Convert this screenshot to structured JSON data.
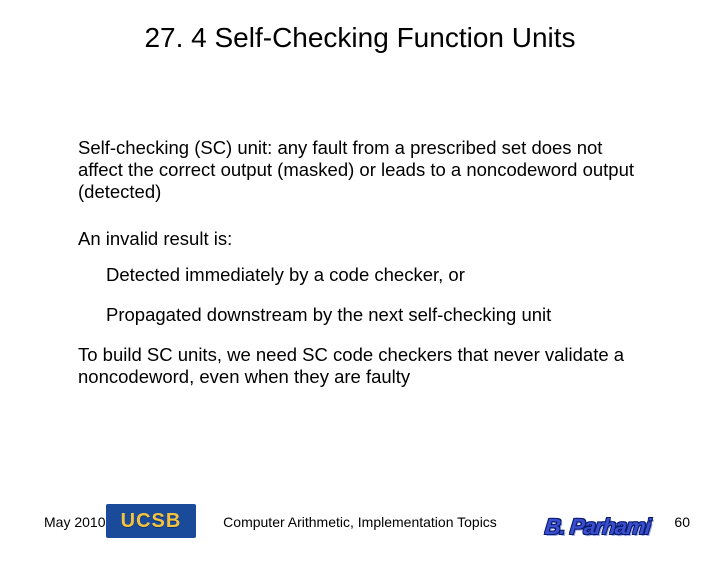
{
  "title": "27. 4  Self-Checking Function Units",
  "body": {
    "p1": "Self-checking (SC) unit: any fault from a prescribed set does not affect the correct output (masked) or leads to a noncodeword output (detected)",
    "p2": "An invalid result is:",
    "item1": "Detected immediately by a code checker, or",
    "item2": "Propagated downstream by the next self-checking unit",
    "p3": "To build SC units, we need SC code checkers that never validate a noncodeword, even when they are faulty"
  },
  "footer": {
    "date": "May 2010",
    "center": "Computer Arithmetic, Implementation Topics",
    "page": "60",
    "ucsb": "UCSB",
    "author": "B. Parhami"
  }
}
